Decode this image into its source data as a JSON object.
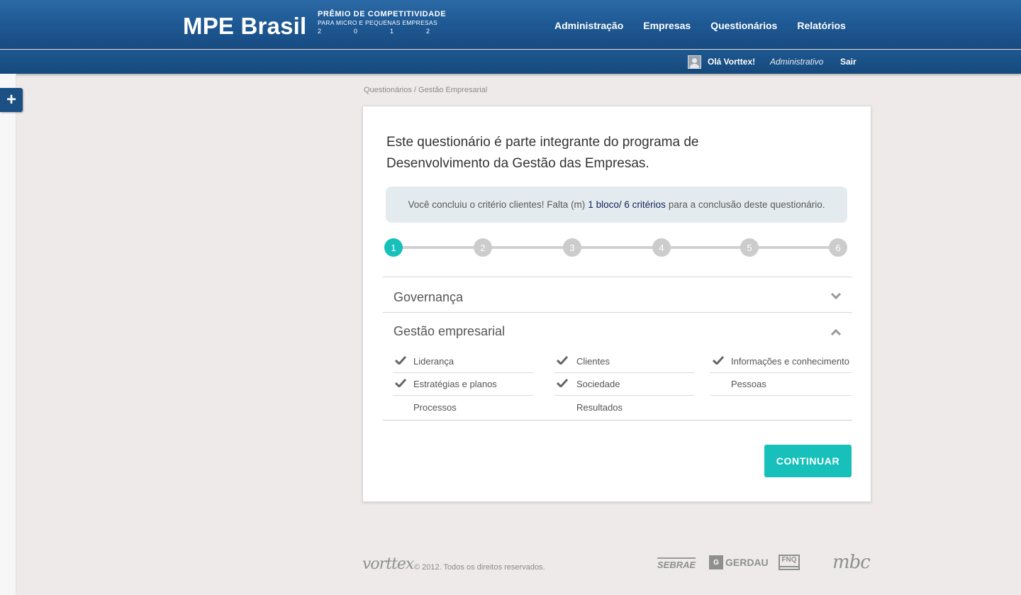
{
  "header": {
    "logo": "MPE Brasil",
    "premio_line1": "PRÊMIO DE COMPETITIVIDADE",
    "premio_line2": "PARA MICRO E PEQUENAS EMPRESAS",
    "year_digits": [
      "2",
      "0",
      "1",
      "2"
    ],
    "nav": [
      "Administração",
      "Empresas",
      "Questionários",
      "Relatórios"
    ]
  },
  "userbar": {
    "greeting": "Olá  Vorttex!",
    "role": "Administrativo",
    "logout": "Sair"
  },
  "sidebar": {
    "toggle_icon": "+"
  },
  "breadcrumb": "Questionários / Gestão Empresarial",
  "card": {
    "intro": "Este questionário é parte integrante do programa de Desenvolvimento da Gestão das Empresas.",
    "notice": {
      "before": "Você concluiu o critério clientes! Falta (m)",
      "highlight": "1 bloco/ 6 critérios",
      "after": "para a conclusão deste questionário."
    },
    "steps": [
      "1",
      "2",
      "3",
      "4",
      "5",
      "6"
    ],
    "current_step": 1,
    "sections": [
      {
        "title": "Governança",
        "expanded": false
      },
      {
        "title": "Gestão empresarial",
        "expanded": true
      }
    ],
    "criteria": [
      {
        "label": "Liderança",
        "done": true
      },
      {
        "label": "Clientes",
        "done": true
      },
      {
        "label": "Informações e conhecimento",
        "done": true
      },
      {
        "label": "Estratégias e planos",
        "done": true
      },
      {
        "label": "Sociedade",
        "done": true
      },
      {
        "label": "Pessoas",
        "done": false
      },
      {
        "label": "Processos",
        "done": false
      },
      {
        "label": "Resultados",
        "done": false
      }
    ],
    "continue_button": "CONTINUAR"
  },
  "footer": {
    "vorttex_logo": "vorttex",
    "copyright": "© 2012. Todos os direitos reservados.",
    "partners": [
      "SEBRAE",
      "GERDAU",
      "FNQ",
      "mbc"
    ],
    "gerdau_mark": "G"
  },
  "colors": {
    "header_blue": "#1f5a95",
    "accent_teal": "#17c0bb",
    "highlight_navy": "#13225a"
  }
}
